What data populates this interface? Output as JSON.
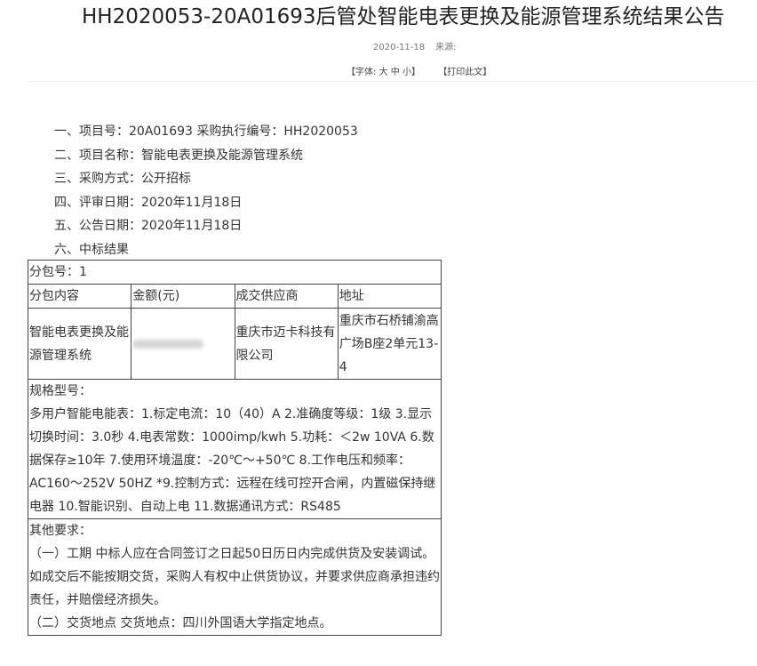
{
  "title": "HH2020053-20A01693后管处智能电表更换及能源管理系统结果公告",
  "meta": {
    "date": "2020-11-18",
    "source_label": "来源:"
  },
  "tools": {
    "font_label": "【字体:",
    "font_large": "大",
    "font_medium": "中",
    "font_small": "小",
    "font_close": "】",
    "print": "【打印此文】"
  },
  "items": [
    "一、项目号：20A01693 采购执行编号：HH2020053",
    "二、项目名称：智能电表更换及能源管理系统",
    "三、采购方式：公开招标",
    "四、评审日期：2020年11月18日",
    "五、公告日期：2020年11月18日",
    "六、中标结果"
  ],
  "table": {
    "package": "分包号：1",
    "headers": [
      "分包内容",
      "金额(元)",
      "成交供应商",
      "地址"
    ],
    "row": {
      "content": "智能电表更换及能源管理系统",
      "supplier": "重庆市迈卡科技有限公司",
      "address": "重庆市石桥铺渝高广场B座2单元13-4"
    },
    "spec_label": "规格型号：",
    "spec_text": "多用户智能电能表：1.标定电流：10（40）A 2.准确度等级：1级 3.显示切换时间：3.0秒 4.电表常数：1000imp/kwh 5.功耗：＜2w 10VA 6.数据保存≥10年 7.使用环境温度：-20℃～+50℃ 8.工作电压和频率：AC160～252V 50HZ *9.控制方式：远程在线可控开合闸，内置磁保持继电器 10.智能识别、自动上电 11.数据通讯方式：RS485",
    "other_label": "其他要求：",
    "other_1": "（一）工期 中标人应在合同签订之日起50日历日内完成供货及安装调试。如成交后不能按期交货，采购人有权中止供货协议，并要求供应商承担违约责任，并赔偿经济损失。",
    "other_2": "（二）交货地点 交货地点：四川外国语大学指定地点。"
  }
}
